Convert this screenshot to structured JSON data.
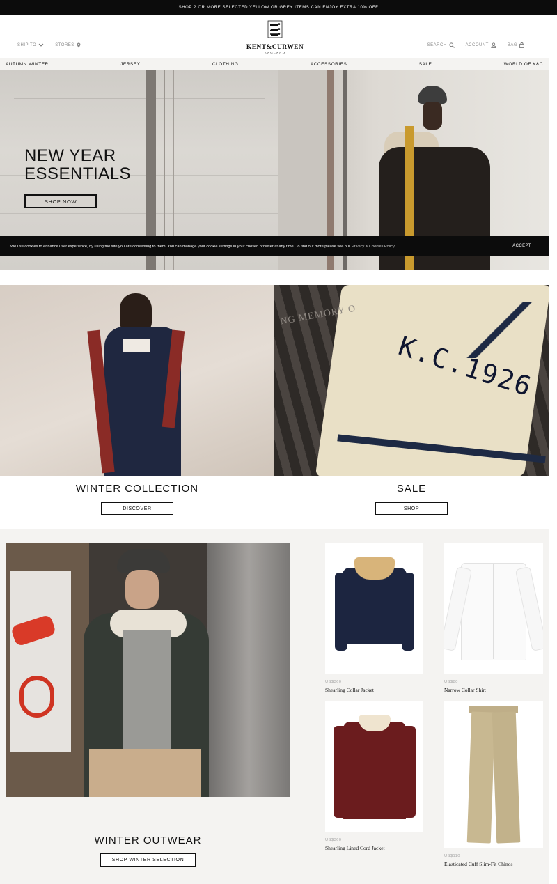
{
  "promo": "SHOP 2 OR MORE SELECTED YELLOW OR GREY ITEMS CAN ENJOY EXTRA 10% OFF",
  "header": {
    "ship_to": "SHIP TO",
    "stores": "STORES",
    "search": "SEARCH",
    "account": "ACCOUNT",
    "bag": "BAG",
    "logo_name": "KENT&CURWEN",
    "logo_sub": "ENGLAND"
  },
  "nav": [
    "AUTUMN WINTER",
    "JERSEY",
    "CLOTHING",
    "ACCESSORIES",
    "SALE",
    "WORLD OF K&C"
  ],
  "hero": {
    "title_line1": "NEW YEAR",
    "title_line2": "ESSENTIALS",
    "button": "SHOP NOW"
  },
  "cookie": {
    "text": "We use cookies to enhance user experience, by using the site you are consenting to them. You can manage your cookie settings in your chosen browser at any time. To find out more please see our",
    "link": "Privacy & Cookies Policy.",
    "accept": "ACCEPT"
  },
  "tiles": [
    {
      "title": "WINTER COLLECTION",
      "button": "DISCOVER"
    },
    {
      "title": "SALE",
      "button": "SHOP",
      "image_text": "K.C.1926",
      "bench_text": "NG MEMORY O"
    }
  ],
  "outwear": {
    "title": "WINTER OUTWEAR",
    "button": "SHOP WINTER SELECTION"
  },
  "products": [
    {
      "price": "US$360",
      "name": "Shearling Collar Jacket"
    },
    {
      "price": "US$80",
      "name": "Narrow Collar Shirt"
    },
    {
      "price": "US$360",
      "name": "Shearling Lined Cord Jacket"
    },
    {
      "price": "US$110",
      "name": "Elasticated Cuff Slim-Fit Chinos"
    }
  ],
  "colors": {
    "black": "#0c0c0c",
    "nav_bg": "#f4f3f1",
    "muted": "#8a8a8a"
  }
}
